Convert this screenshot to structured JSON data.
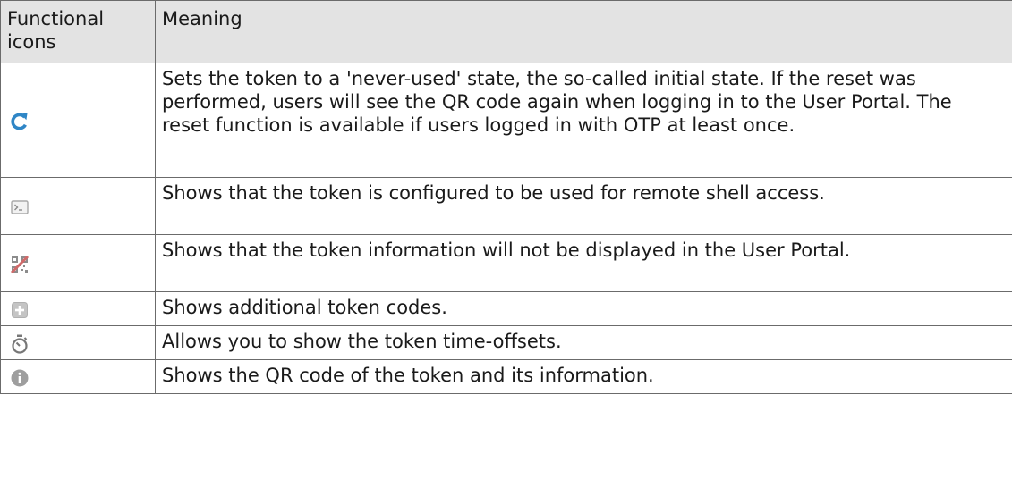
{
  "table": {
    "headers": {
      "icon_col": "Functional icons",
      "meaning_col": "Meaning"
    },
    "rows": [
      {
        "icon": "reset-icon",
        "meaning": "Sets the token to a 'never-used' state, the so-called initial state. If the reset was performed, users will see the QR code again when logging in to the User Portal. The reset function is available if users logged in with OTP at least once."
      },
      {
        "icon": "shell-icon",
        "meaning": "Shows that the token is configured to be used for remote shell access."
      },
      {
        "icon": "qr-hidden-icon",
        "meaning": "Shows that the token information will not be displayed in the User Portal."
      },
      {
        "icon": "add-icon",
        "meaning": "Shows additional token codes."
      },
      {
        "icon": "stopwatch-icon",
        "meaning": "Allows you to show the token time-offsets."
      },
      {
        "icon": "info-icon",
        "meaning": "Shows the QR code of the token and its information."
      }
    ]
  },
  "colors": {
    "header_bg": "#e3e3e3",
    "border": "#6b6b6b",
    "reset_icon": "#2f86c6"
  }
}
